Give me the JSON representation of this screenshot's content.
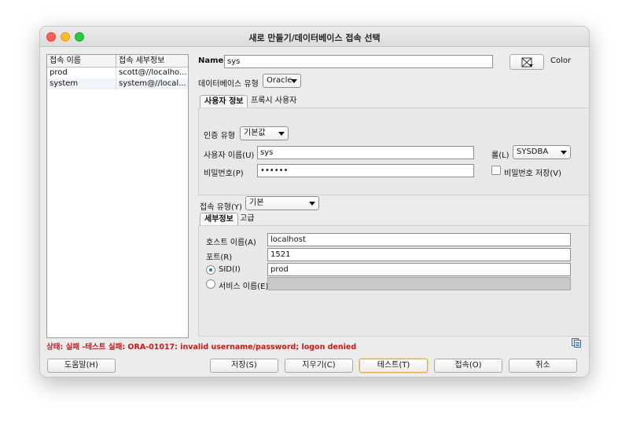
{
  "window": {
    "title": "새로 만들기/데이터베이스 접속 선택"
  },
  "connections": {
    "headers": [
      "접속 이름",
      "접속 세부정보"
    ],
    "rows": [
      {
        "name": "prod",
        "details": "scott@//localho..."
      },
      {
        "name": "system",
        "details": "system@//local..."
      }
    ]
  },
  "form": {
    "name_label": "Name",
    "name_value": "sys",
    "color_label": "Color",
    "db_type_label": "데이터베이스 유형",
    "db_type_value": "Oracle",
    "tabs": [
      "사용자 정보",
      "프록시 사용자"
    ],
    "auth_type_label": "인증 유형",
    "auth_type_value": "기본값",
    "username_label": "사용자 이름(U)",
    "username_value": "sys",
    "role_label": "롤(L)",
    "role_value": "SYSDBA",
    "password_label": "비밀번호(P)",
    "password_value": "••••••",
    "save_password_label": "비밀번호 저장(V)",
    "conn_type_label": "접속 유형(Y)",
    "conn_type_value": "기본",
    "detail_tabs": [
      "세부정보",
      "고급"
    ],
    "host_label": "호스트 이름(A)",
    "host_value": "localhost",
    "port_label": "포트(R)",
    "port_value": "1521",
    "sid_label": "SID(I)",
    "sid_value": "prod",
    "service_label": "서비스 이름(E)",
    "service_value": ""
  },
  "status": {
    "text": "상태: 실패 -테스트 실패: ORA-01017: invalid username/password; logon denied"
  },
  "buttons": {
    "help": "도움말(H)",
    "save": "저장(S)",
    "clear": "지우기(C)",
    "test": "테스트(T)",
    "connect": "접속(O)",
    "cancel": "취소"
  },
  "colors": {
    "status_error": "#c31a1a",
    "radio_selected": "#2b6ad0"
  },
  "icons": {
    "color_picker": "color-picker-icon",
    "copy_status": "copy-icon"
  }
}
